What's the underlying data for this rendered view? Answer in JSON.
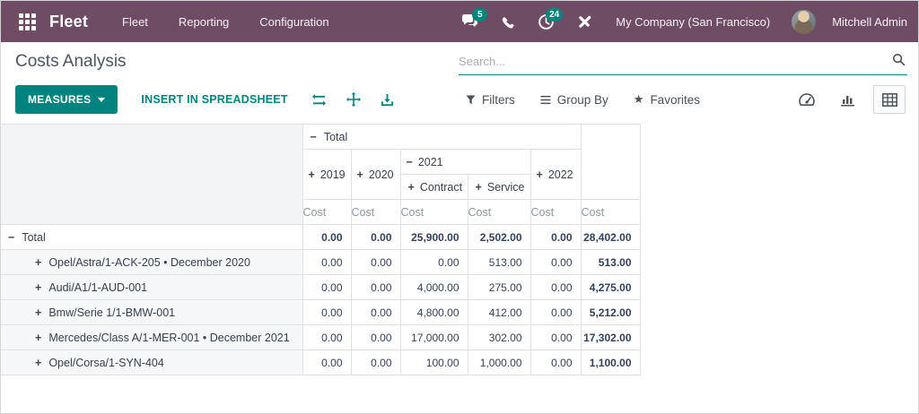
{
  "navbar": {
    "app_name": "Fleet",
    "menus": [
      "Fleet",
      "Reporting",
      "Configuration"
    ],
    "messages_badge": "5",
    "activities_badge": "24",
    "company_name": "My Company (San Francisco)",
    "user_name": "Mitchell Admin"
  },
  "page": {
    "title": "Costs Analysis"
  },
  "search": {
    "placeholder": "Search..."
  },
  "control_panel": {
    "measures": "MEASURES",
    "insert_in_spreadsheet": "INSERT IN SPREADSHEET",
    "filters": "Filters",
    "group_by": "Group By",
    "favorites": "Favorites"
  },
  "icons": {
    "star": "★"
  },
  "colors": {
    "navbar_bg": "#6e4d64",
    "accent_teal": "#00827e",
    "table_border": "#dee2e6",
    "muted_header": "#8d97a2"
  },
  "pivot": {
    "col_root": {
      "sign": "−",
      "label": "Total"
    },
    "col_headers": [
      {
        "sign": "+",
        "label": "2019"
      },
      {
        "sign": "+",
        "label": "2020"
      },
      {
        "sign": "−",
        "label": "2021"
      },
      {
        "sign": "+",
        "label": "2022"
      }
    ],
    "col_subheaders": [
      {
        "sign": "+",
        "label": "Contract"
      },
      {
        "sign": "+",
        "label": "Service"
      }
    ],
    "measure": "Cost",
    "rows": [
      {
        "sign": "−",
        "label": "Total",
        "values": [
          "0.00",
          "0.00",
          "25,900.00",
          "2,502.00",
          "0.00",
          "28,402.00"
        ]
      },
      {
        "sign": "+",
        "label": "Opel/Astra/1-ACK-205 • December 2020",
        "values": [
          "0.00",
          "0.00",
          "0.00",
          "513.00",
          "0.00",
          "513.00"
        ]
      },
      {
        "sign": "+",
        "label": "Audi/A1/1-AUD-001",
        "values": [
          "0.00",
          "0.00",
          "4,000.00",
          "275.00",
          "0.00",
          "4,275.00"
        ]
      },
      {
        "sign": "+",
        "label": "Bmw/Serie 1/1-BMW-001",
        "values": [
          "0.00",
          "0.00",
          "4,800.00",
          "412.00",
          "0.00",
          "5,212.00"
        ]
      },
      {
        "sign": "+",
        "label": "Mercedes/Class A/1-MER-001 • December 2021",
        "values": [
          "0.00",
          "0.00",
          "17,000.00",
          "302.00",
          "0.00",
          "17,302.00"
        ]
      },
      {
        "sign": "+",
        "label": "Opel/Corsa/1-SYN-404",
        "values": [
          "0.00",
          "0.00",
          "100.00",
          "1,000.00",
          "0.00",
          "1,100.00"
        ]
      }
    ]
  }
}
